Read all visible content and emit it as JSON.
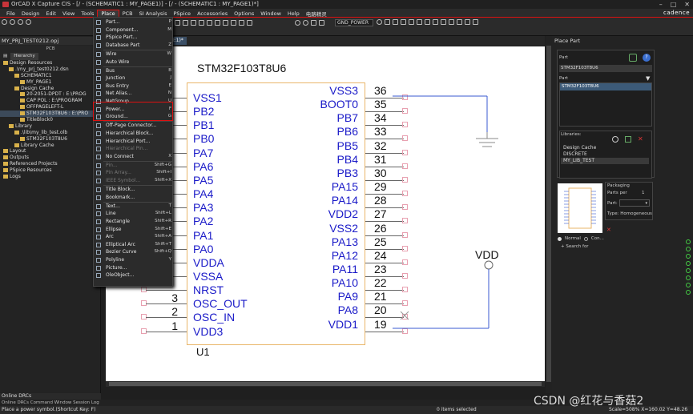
{
  "window": {
    "title": "OrCAD X Capture CIS - [/ - (SCHEMATIC1 : MY_PAGE1)] - [/ - (SCHEMATIC1 : MY_PAGE1)*]",
    "brand": "cadence"
  },
  "menubar": [
    "File",
    "Design",
    "Edit",
    "View",
    "Tools",
    "Place",
    "PCB",
    "SI Analysis",
    "PSpice",
    "Accessories",
    "Options",
    "Window",
    "Help",
    "电路精灵"
  ],
  "toolbar": {
    "part_combo": "GND_POWER"
  },
  "project": {
    "title": "MY_PRJ_TEST0212.opj",
    "tab_pcb": "PCB",
    "tab_hierarchy": "Hierarchy",
    "tree": [
      {
        "label": "Design Resources",
        "indent": 0
      },
      {
        "label": ".\\my_prj_test0212.dsn",
        "indent": 1
      },
      {
        "label": "SCHEMATIC1",
        "indent": 2
      },
      {
        "label": "MY_PAGE1",
        "indent": 3
      },
      {
        "label": "Design Cache",
        "indent": 2
      },
      {
        "label": "20-2051-DPDT : E:\\PROG",
        "indent": 3
      },
      {
        "label": "CAP POL : E:\\PROGRAM",
        "indent": 3
      },
      {
        "label": "OFFPAGELEFT-L",
        "indent": 3
      },
      {
        "label": "STM32F103T8U6 : E:\\PRO",
        "indent": 3,
        "selected": true
      },
      {
        "label": "TitleBlock0",
        "indent": 3
      },
      {
        "label": "Library",
        "indent": 1
      },
      {
        "label": ".\\lib\\my_lib_test.olb",
        "indent": 2
      },
      {
        "label": "STM32F103T8U6",
        "indent": 3
      },
      {
        "label": "Library Cache",
        "indent": 2
      },
      {
        "label": "Layout",
        "indent": 0
      },
      {
        "label": "Outputs",
        "indent": 0
      },
      {
        "label": "Referenced Projects",
        "indent": 0
      },
      {
        "label": "PSpice Resources",
        "indent": 0
      },
      {
        "label": "Logs",
        "indent": 0
      }
    ]
  },
  "place_menu": {
    "items": [
      {
        "label": "Part...",
        "key": "P"
      },
      {
        "label": "Component...",
        "key": "M"
      },
      {
        "label": "PSpice Part...",
        "key": ""
      },
      {
        "label": "Database Part",
        "key": "Z"
      },
      {
        "label": "Wire",
        "key": "W"
      },
      {
        "label": "Auto Wire",
        "key": ""
      },
      {
        "label": "Bus",
        "key": "B"
      },
      {
        "label": "Junction",
        "key": "J"
      },
      {
        "label": "Bus Entry",
        "key": "E"
      },
      {
        "label": "Net Alias...",
        "key": "N"
      },
      {
        "label": "NetGroup...",
        "key": "U"
      },
      {
        "label": "Power...",
        "key": "F"
      },
      {
        "label": "Ground...",
        "key": "G"
      },
      {
        "label": "Off-Page Connector...",
        "key": ""
      },
      {
        "label": "Hierarchical Block...",
        "key": ""
      },
      {
        "label": "Hierarchical Port...",
        "key": ""
      },
      {
        "label": "Hierarchical Pin...",
        "key": "",
        "disabled": true
      },
      {
        "label": "No Connect",
        "key": "X"
      },
      {
        "label": "Pin...",
        "key": "Shift+G",
        "disabled": true
      },
      {
        "label": "Pin Array...",
        "key": "Shift+I",
        "disabled": true
      },
      {
        "label": "IEEE Symbol...",
        "key": "Shift+X",
        "disabled": true
      },
      {
        "label": "Title Block...",
        "key": ""
      },
      {
        "label": "Bookmark...",
        "key": ""
      },
      {
        "label": "Text...",
        "key": "T"
      },
      {
        "label": "Line",
        "key": "Shift+L"
      },
      {
        "label": "Rectangle",
        "key": "Shift+R"
      },
      {
        "label": "Ellipse",
        "key": "Shift+E"
      },
      {
        "label": "Arc",
        "key": "Shift+A"
      },
      {
        "label": "Elliptical Arc",
        "key": "Shift+T"
      },
      {
        "label": "Bezier Curve",
        "key": "Shift+Q"
      },
      {
        "label": "Polyline",
        "key": "Y"
      },
      {
        "label": "Picture...",
        "key": ""
      },
      {
        "label": "OleObject...",
        "key": ""
      }
    ]
  },
  "canvas": {
    "page_tab": "PAGE1)*",
    "chip_name": "STM32F103T8U6",
    "ref": "U1",
    "vdd_label": "VDD",
    "left_pins": [
      {
        "num": "",
        "name": "VSS1"
      },
      {
        "num": "",
        "name": "PB2"
      },
      {
        "num": "",
        "name": "PB1"
      },
      {
        "num": "",
        "name": "PB0"
      },
      {
        "num": "",
        "name": "PA7"
      },
      {
        "num": "",
        "name": "PA6"
      },
      {
        "num": "",
        "name": "PA5"
      },
      {
        "num": "",
        "name": "PA4"
      },
      {
        "num": "",
        "name": "PA3"
      },
      {
        "num": "",
        "name": "PA2"
      },
      {
        "num": "",
        "name": "PA1"
      },
      {
        "num": "",
        "name": "PA0"
      },
      {
        "num": "",
        "name": "VDDA"
      },
      {
        "num": "",
        "name": "VSSA"
      },
      {
        "num": "",
        "name": "NRST"
      },
      {
        "num": "3",
        "name": "OSC_OUT"
      },
      {
        "num": "2",
        "name": "OSC_IN"
      },
      {
        "num": "1",
        "name": "VDD3"
      }
    ],
    "right_pins": [
      {
        "num": "36",
        "name": "VSS3"
      },
      {
        "num": "35",
        "name": "BOOT0"
      },
      {
        "num": "34",
        "name": "PB7"
      },
      {
        "num": "33",
        "name": "PB6"
      },
      {
        "num": "32",
        "name": "PB5"
      },
      {
        "num": "31",
        "name": "PB4"
      },
      {
        "num": "30",
        "name": "PB3"
      },
      {
        "num": "29",
        "name": "PA15"
      },
      {
        "num": "28",
        "name": "PA14"
      },
      {
        "num": "27",
        "name": "VDD2"
      },
      {
        "num": "26",
        "name": "VSS2"
      },
      {
        "num": "25",
        "name": "PA13"
      },
      {
        "num": "24",
        "name": "PA12"
      },
      {
        "num": "23",
        "name": "PA11"
      },
      {
        "num": "22",
        "name": "PA10"
      },
      {
        "num": "21",
        "name": "PA9"
      },
      {
        "num": "20",
        "name": "PA8"
      },
      {
        "num": "19",
        "name": "VDD1"
      }
    ]
  },
  "place_part": {
    "title": "Place Part",
    "part_label": "Part",
    "part_value": "STM32F103T8U6",
    "part_list_label": "Part",
    "part_list_item": "STM32F103T8U6",
    "libraries_label": "Libraries:",
    "libraries": [
      "Design Cache",
      "DISCRETE",
      "MY_LIB_TEST"
    ],
    "packaging_label": "Packaging",
    "parts_per_label": "Parts per",
    "parts_per_value": "1",
    "part_field_label": "Part:",
    "type_label": "Type: Homogeneous",
    "radio_normal": "Normal",
    "radio_convert": "Con...",
    "search_label": "Search for"
  },
  "bottom": {
    "left_title": "Online DRCs",
    "tabs": "Online DRCs   Command Window   Session Log",
    "status_hint": "Place a power symbol.(Shortcut Key: F)",
    "items_selected": "0 items selected",
    "scale": "Scale=508%  X=160.02  Y=48.26"
  },
  "watermark": "CSDN @红花与香菇2"
}
